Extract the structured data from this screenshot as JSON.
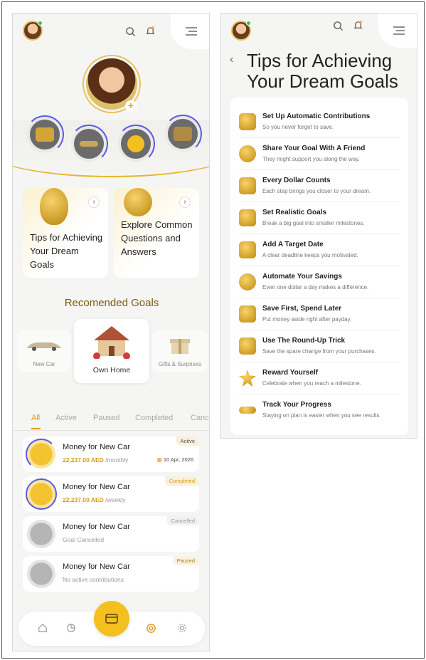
{
  "left": {
    "tip_cards": [
      {
        "label": "Tips for Achieving Your Dream Goals"
      },
      {
        "label": "Explore Common Questions and Answers"
      }
    ],
    "recommended_title": "Recomended Goals",
    "recommended": [
      {
        "label": "New Car"
      },
      {
        "label": "Own Home"
      },
      {
        "label": "Gifts & Surprises"
      }
    ],
    "tabs": [
      "All",
      "Active",
      "Paused",
      "Completed",
      "Canc"
    ],
    "goals": [
      {
        "title": "Money for New Car",
        "amount": "22,237.00 AED",
        "freq": " /monthly",
        "badge": "Active",
        "date": "10 Apr, 2026"
      },
      {
        "title": "Money for New Car",
        "amount": "22,237.00 AED",
        "freq": " /weekly",
        "badge": "Completed"
      },
      {
        "title": "Money for New Car",
        "note": "Goal Cancelled",
        "badge": "Cancelled"
      },
      {
        "title": "Money for New Car",
        "note": "No active contributions",
        "badge": "Paused"
      }
    ],
    "plus": "+"
  },
  "right": {
    "title": "Tips for Achieving Your Dream Goals",
    "back": "‹",
    "tips": [
      {
        "title": "Set Up Automatic Contributions",
        "desc": "So you never forget to save."
      },
      {
        "title": "Share Your Goal With A Friend",
        "desc": "They might support you along the way."
      },
      {
        "title": "Every Dollar Counts",
        "desc": "Each step brings you closer to your dream."
      },
      {
        "title": "Set Realistic Goals",
        "desc": "Break a big goal into smaller milestones."
      },
      {
        "title": "Add A Target Date",
        "desc": "A clear deadline keeps you motivated."
      },
      {
        "title": "Automate Your Savings",
        "desc": "Even one dollar a day makes a difference."
      },
      {
        "title": "Save First, Spend Later",
        "desc": "Put money aside right after payday."
      },
      {
        "title": "Use The Round-Up Trick",
        "desc": "Save the spare change from your purchases."
      },
      {
        "title": "Reward Yourself",
        "desc": "Celebrate when you reach a milestone."
      },
      {
        "title": "Track Your Progress",
        "desc": "Staying on plan is easier when you see results."
      }
    ]
  },
  "colors": {
    "accent": "#d99b13",
    "fab": "#f3c01f",
    "ring": "#5b5be0"
  },
  "icons": [
    "search-icon",
    "bell-icon",
    "menu-icon",
    "home-icon",
    "chart-icon",
    "card-icon",
    "target-icon",
    "settings-icon"
  ]
}
